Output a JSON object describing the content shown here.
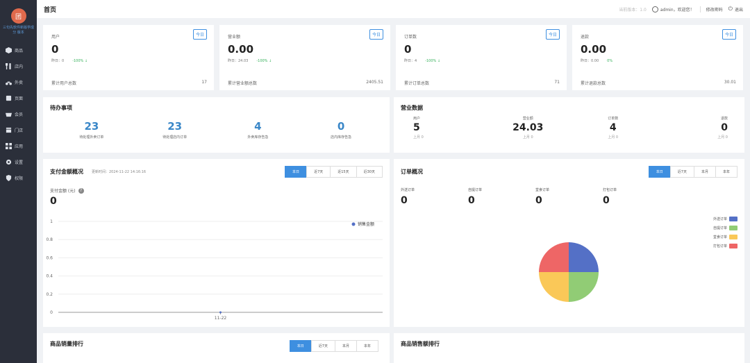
{
  "sidebar": {
    "logo_glyph": "团",
    "shop_name": "三句先软件新版学成分 版本",
    "items": [
      {
        "label": "商品",
        "icon": "cube-icon"
      },
      {
        "label": "店内",
        "icon": "utensils-icon"
      },
      {
        "label": "外卖",
        "icon": "scooter-icon"
      },
      {
        "label": "页面",
        "icon": "page-icon"
      },
      {
        "label": "会员",
        "icon": "basket-icon"
      },
      {
        "label": "门店",
        "icon": "store-icon"
      },
      {
        "label": "应用",
        "icon": "apps-icon"
      },
      {
        "label": "设置",
        "icon": "gear-icon"
      },
      {
        "label": "权限",
        "icon": "shield-icon"
      }
    ]
  },
  "topbar": {
    "title": "首页",
    "version": "当前版本：1.0",
    "user": "admin，欢迎您！",
    "change_password": "修改密码",
    "logout": "退出"
  },
  "stats": [
    {
      "label": "用户",
      "today": "今日",
      "value": "0",
      "yesterday": "昨日：0",
      "pct": "-100% ↓",
      "foot_label": "累计用户总数",
      "foot_value": "17"
    },
    {
      "label": "营业额",
      "today": "今日",
      "value": "0.00",
      "yesterday": "昨日：24.03",
      "pct": "-100% ↓",
      "foot_label": "累计营业额总数",
      "foot_value": "2405.51"
    },
    {
      "label": "订单数",
      "today": "今日",
      "value": "0",
      "yesterday": "昨日：4",
      "pct": "-100% ↓",
      "foot_label": "累计订单总数",
      "foot_value": "71"
    },
    {
      "label": "退款",
      "today": "今日",
      "value": "0.00",
      "yesterday": "昨日：0.00",
      "pct": "0%",
      "foot_label": "累计退款总数",
      "foot_value": "30.01"
    }
  ],
  "todo": {
    "title": "待办事项",
    "items": [
      {
        "value": "23",
        "label": "待处理外卖订单"
      },
      {
        "value": "23",
        "label": "待处理店内订单"
      },
      {
        "value": "4",
        "label": "外卖库存告急"
      },
      {
        "value": "0",
        "label": "店内库存告急"
      }
    ]
  },
  "business": {
    "title": "营业数据",
    "items": [
      {
        "label": "用户",
        "value": "5",
        "prev": "上月 0"
      },
      {
        "label": "营业额",
        "value": "24.03",
        "prev": "上月 0"
      },
      {
        "label": "订单数",
        "value": "4",
        "prev": "上月 0"
      },
      {
        "label": "退款",
        "value": "0",
        "prev": "上月 0"
      }
    ]
  },
  "payment": {
    "title": "支付金额概况",
    "update_time": "更新时间：2024-11-22 14:16:16",
    "tabs": [
      "本日",
      "近7天",
      "近15天",
      "近30天"
    ],
    "active_tab": 0,
    "amount_label": "支付金额 (元)",
    "amount_value": "0"
  },
  "orders": {
    "title": "订单概况",
    "tabs": [
      "本日",
      "近7天",
      "本月",
      "本年"
    ],
    "active_tab": 0,
    "stats": [
      {
        "label": "外送订单",
        "value": "0"
      },
      {
        "label": "自提订单",
        "value": "0"
      },
      {
        "label": "堂食订单",
        "value": "0"
      },
      {
        "label": "打包订单",
        "value": "0"
      }
    ]
  },
  "rank_left": {
    "title": "商品销量排行",
    "tabs": [
      "本日",
      "近7天",
      "本月",
      "本年"
    ],
    "active_tab": 0
  },
  "rank_right": {
    "title": "商品销售额排行"
  },
  "chart_data": [
    {
      "type": "line",
      "title": "",
      "x": [
        "11-22"
      ],
      "series": [
        {
          "name": "销售金额",
          "values": [
            0
          ]
        }
      ],
      "ylim": [
        0,
        1
      ],
      "yticks": [
        "0",
        "0.2",
        "0.4",
        "0.6",
        "0.8",
        "1"
      ],
      "grid": true,
      "legend": "top-right",
      "colors": [
        "#5470c6"
      ]
    },
    {
      "type": "pie",
      "categories": [
        "外送订单",
        "自提订单",
        "堂食订单",
        "打包订单"
      ],
      "values": [
        1,
        1,
        1,
        1
      ],
      "legend": "right",
      "colors": [
        "#5470c6",
        "#91cc75",
        "#fac858",
        "#ee6666"
      ]
    }
  ]
}
